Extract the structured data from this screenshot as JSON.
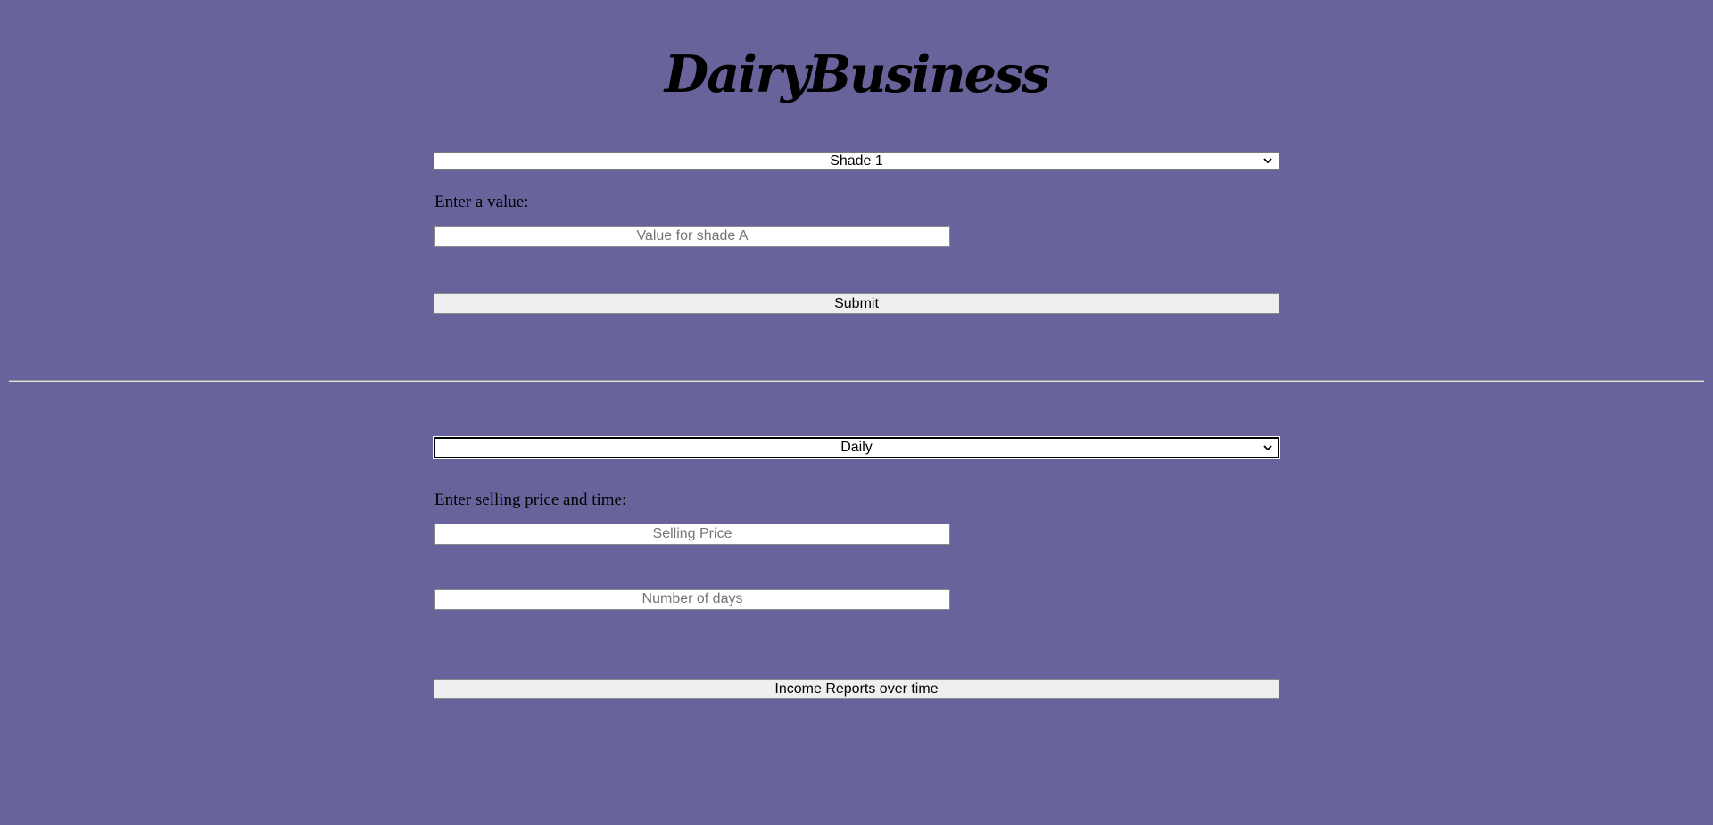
{
  "app": {
    "title": "DairyBusiness"
  },
  "shade_form": {
    "select_value": "Shade 1",
    "label": "Enter a value:",
    "input_placeholder": "Value for shade A",
    "input_value": "",
    "submit_label": "Submit"
  },
  "income_form": {
    "select_value": "Daily",
    "label": "Enter selling price and time:",
    "price_placeholder": "Selling Price",
    "price_value": "",
    "days_placeholder": "Number of days",
    "days_value": "",
    "report_button_label": "Income Reports over time"
  },
  "icons": {
    "select_arrow": "chevron-down-icon"
  },
  "colors": {
    "background": "#68649b",
    "button_background": "#efefef",
    "field_background": "#ffffff"
  }
}
